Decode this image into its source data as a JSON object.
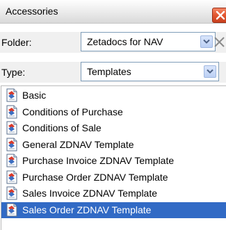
{
  "panel": {
    "title": "Accessories",
    "close_icon": "close-icon"
  },
  "folder": {
    "label": "Folder:",
    "value": "Zetadocs for NAV",
    "clear_icon": "clear-icon"
  },
  "type": {
    "label": "Type:",
    "value": "Templates"
  },
  "templates": {
    "items": [
      {
        "label": "Basic",
        "selected": false
      },
      {
        "label": "Conditions of Purchase",
        "selected": false
      },
      {
        "label": "Conditions of Sale",
        "selected": false
      },
      {
        "label": "General ZDNAV Template",
        "selected": false
      },
      {
        "label": "Purchase Invoice ZDNAV Template",
        "selected": false
      },
      {
        "label": "Purchase Order ZDNAV Template",
        "selected": false
      },
      {
        "label": "Sales Invoice ZDNAV Template",
        "selected": false
      },
      {
        "label": "Sales Order ZDNAV Template",
        "selected": true
      }
    ],
    "item_icon": "document-template-icon"
  },
  "colors": {
    "selection": "#316ac5",
    "close_button": "#e2562f"
  }
}
